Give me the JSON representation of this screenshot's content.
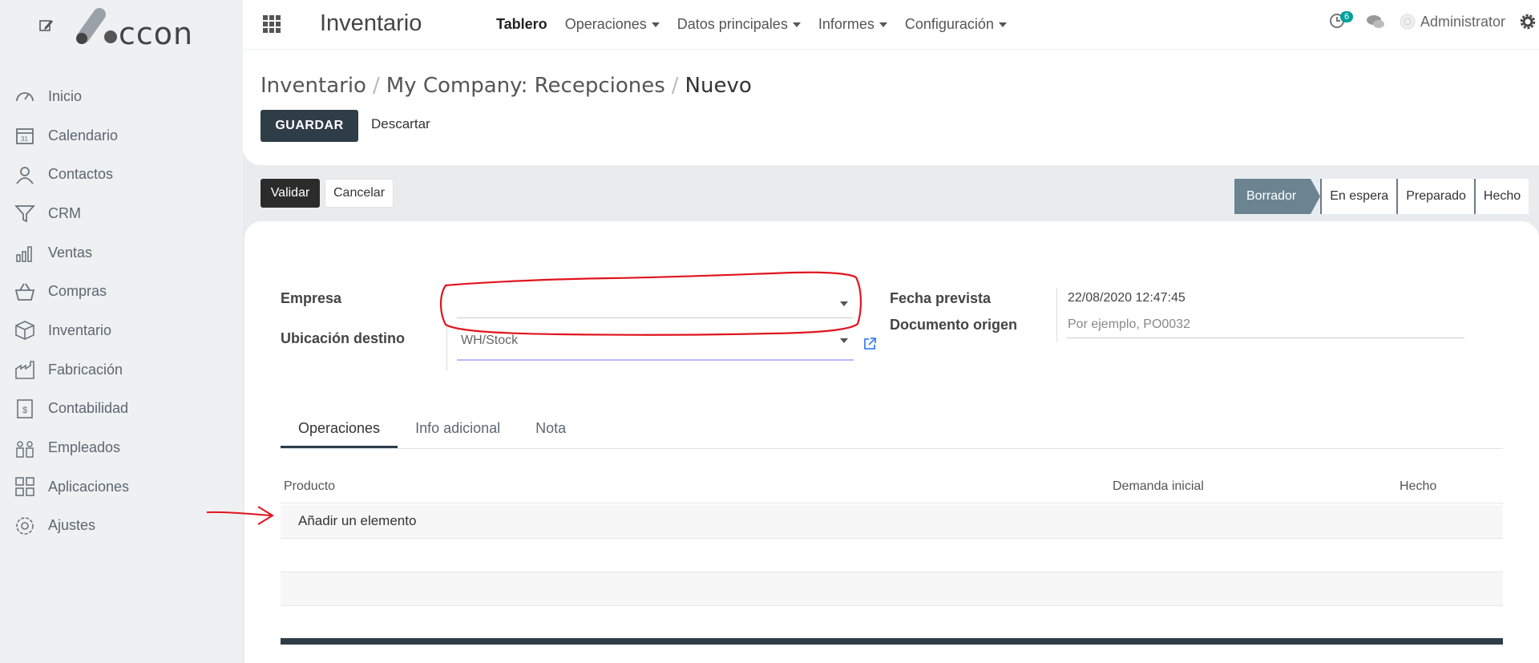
{
  "sidebar": {
    "logo_text": "ccon",
    "items": [
      {
        "label": "Inicio",
        "icon": "speedometer-icon"
      },
      {
        "label": "Calendario",
        "icon": "calendar-icon"
      },
      {
        "label": "Contactos",
        "icon": "person-icon"
      },
      {
        "label": "CRM",
        "icon": "funnel-icon"
      },
      {
        "label": "Ventas",
        "icon": "bar-chart-icon"
      },
      {
        "label": "Compras",
        "icon": "basket-icon"
      },
      {
        "label": "Inventario",
        "icon": "box-icon"
      },
      {
        "label": "Fabricación",
        "icon": "factory-icon"
      },
      {
        "label": "Contabilidad",
        "icon": "invoice-icon"
      },
      {
        "label": "Empleados",
        "icon": "people-icon"
      },
      {
        "label": "Aplicaciones",
        "icon": "apps-grid-icon"
      },
      {
        "label": "Ajustes",
        "icon": "gear-icon"
      }
    ]
  },
  "topbar": {
    "app_title": "Inventario",
    "menu": [
      "Tablero",
      "Operaciones",
      "Datos principales",
      "Informes",
      "Configuración"
    ],
    "activity_count": "6",
    "user": "Administrator"
  },
  "breadcrumb": [
    "Inventario",
    "My Company: Recepciones",
    "Nuevo"
  ],
  "actions": {
    "save": "GUARDAR",
    "discard": "Descartar",
    "validate": "Validar",
    "cancel": "Cancelar"
  },
  "stages": [
    "Borrador",
    "En espera",
    "Preparado",
    "Hecho"
  ],
  "form": {
    "empresa_label": "Empresa",
    "empresa_value": "",
    "ubicacion_label": "Ubicación destino",
    "ubicacion_value": "WH/Stock",
    "fecha_label": "Fecha prevista",
    "fecha_value": "22/08/2020 12:47:45",
    "origen_label": "Documento origen",
    "origen_placeholder": "Por ejemplo, PO0032"
  },
  "tabs": [
    "Operaciones",
    "Info adicional",
    "Nota"
  ],
  "table": {
    "columns": [
      "Producto",
      "Demanda inicial",
      "Hecho"
    ],
    "add_line": "Añadir un elemento"
  },
  "colors": {
    "annotation": "#e0141e",
    "primary": "#2f3d47",
    "stage_active": "#6c8391"
  }
}
